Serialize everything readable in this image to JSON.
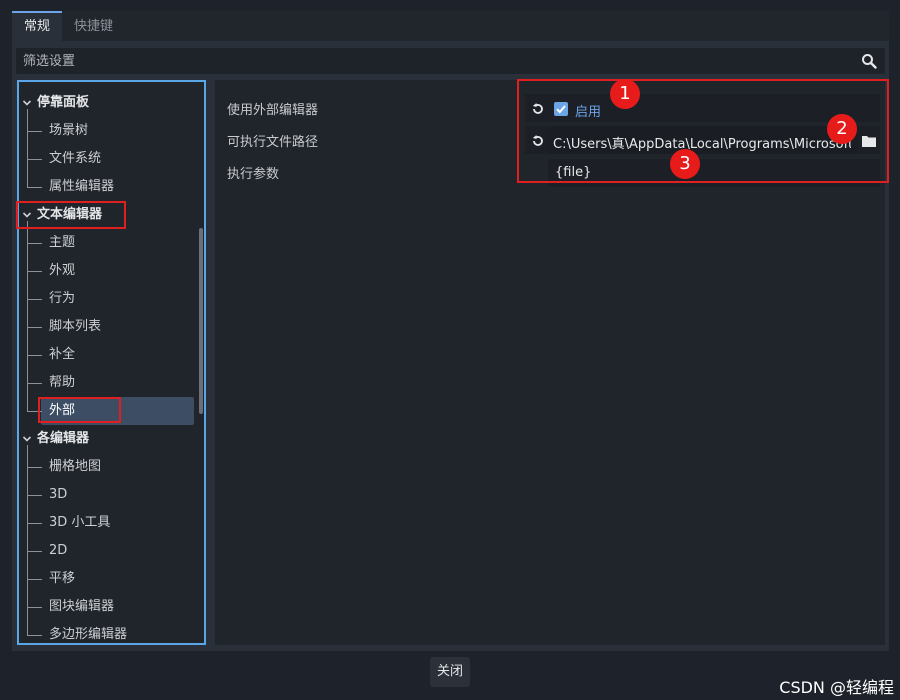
{
  "tabs": [
    {
      "label": "常规",
      "active": true
    },
    {
      "label": "快捷键",
      "active": false
    }
  ],
  "filter": {
    "placeholder": "筛选设置"
  },
  "tree": {
    "items": [
      {
        "label": "停靠面板",
        "level": 0
      },
      {
        "label": "场景树",
        "level": 1
      },
      {
        "label": "文件系统",
        "level": 1
      },
      {
        "label": "属性编辑器",
        "level": 1
      },
      {
        "label": "文本编辑器",
        "level": 0
      },
      {
        "label": "主题",
        "level": 1
      },
      {
        "label": "外观",
        "level": 1
      },
      {
        "label": "行为",
        "level": 1
      },
      {
        "label": "脚本列表",
        "level": 1
      },
      {
        "label": "补全",
        "level": 1
      },
      {
        "label": "帮助",
        "level": 1
      },
      {
        "label": "外部",
        "level": 1,
        "selected": true
      },
      {
        "label": "各编辑器",
        "level": 0
      },
      {
        "label": "栅格地图",
        "level": 1
      },
      {
        "label": "3D",
        "level": 1
      },
      {
        "label": "3D 小工具",
        "level": 1
      },
      {
        "label": "2D",
        "level": 1
      },
      {
        "label": "平移",
        "level": 1
      },
      {
        "label": "图块编辑器",
        "level": 1
      },
      {
        "label": "多边形编辑器",
        "level": 1
      }
    ]
  },
  "properties": {
    "use_external": {
      "label": "使用外部编辑器",
      "value": "启用",
      "checked": true
    },
    "exec_path": {
      "label": "可执行文件路径",
      "value": "C:\\Users\\真\\AppData\\Local\\Programs\\Microsoft VS Code\\Code.exe"
    },
    "exec_flags": {
      "label": "执行参数",
      "value": "{file}"
    }
  },
  "annotations": [
    "1",
    "2",
    "3"
  ],
  "footer": {
    "close_label": "关闭"
  },
  "watermark": "CSDN @轻编程",
  "colors": {
    "accent": "#6ca4e8",
    "annotation_red": "#e81b1b",
    "tree_border": "#5aa6e6"
  }
}
